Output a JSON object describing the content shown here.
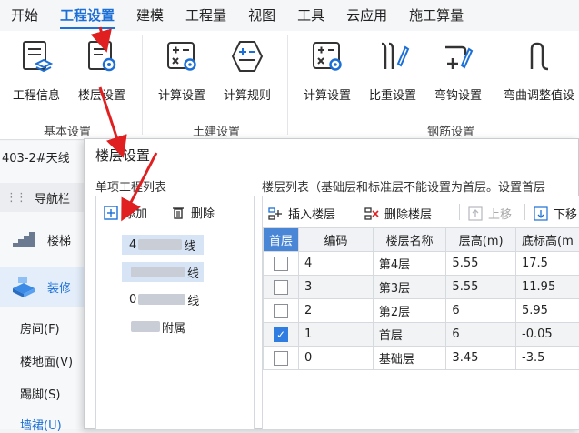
{
  "menu": [
    "开始",
    "工程设置",
    "建模",
    "工程量",
    "视图",
    "工具",
    "云应用",
    "施工算量"
  ],
  "ribbon": {
    "buttons": [
      {
        "label": "工程信息",
        "icon": "project-info-icon"
      },
      {
        "label": "楼层设置",
        "icon": "floor-settings-icon"
      },
      {
        "label": "计算设置",
        "icon": "calc-settings-icon"
      },
      {
        "label": "计算规则",
        "icon": "calc-rules-icon"
      },
      {
        "label": "计算设置",
        "icon": "rebar-calc-settings-icon"
      },
      {
        "label": "比重设置",
        "icon": "density-settings-icon"
      },
      {
        "label": "弯钩设置",
        "icon": "hook-settings-icon"
      },
      {
        "label": "弯曲调整值设",
        "icon": "bend-adjust-icon"
      }
    ],
    "groups": [
      "基本设置",
      "土建设置",
      "钢筋设置"
    ]
  },
  "left": {
    "project_title": "403-2#天线",
    "nav_header": "导航栏",
    "nav_items": [
      "楼梯",
      "装修"
    ],
    "sub_items": [
      "房间(F)",
      "楼地面(V)",
      "踢脚(S)",
      "墙裙(U)"
    ]
  },
  "dialog": {
    "title": "楼层设置",
    "project_list_label": "单项工程列表",
    "add_label": "添加",
    "delete_label": "删除",
    "projects": [
      {
        "prefix": "4",
        "suffix": "线"
      },
      {
        "prefix": "",
        "suffix": "线"
      },
      {
        "prefix": "0",
        "suffix": "线"
      },
      {
        "prefix": "",
        "suffix": "附属"
      }
    ],
    "floor_list_label": "楼层列表（基础层和标准层不能设置为首层。设置首层",
    "insert_floor": "插入楼层",
    "delete_floor": "删除楼层",
    "move_up": "上移",
    "move_down": "下移",
    "columns": [
      "首层",
      "编码",
      "楼层名称",
      "层高(m)",
      "底标高(m"
    ],
    "rows": [
      {
        "first": false,
        "code": "4",
        "name": "第4层",
        "height": "5.55",
        "bottom": "17.5"
      },
      {
        "first": false,
        "code": "3",
        "name": "第3层",
        "height": "5.55",
        "bottom": "11.95"
      },
      {
        "first": false,
        "code": "2",
        "name": "第2层",
        "height": "6",
        "bottom": "5.95"
      },
      {
        "first": true,
        "code": "1",
        "name": "首层",
        "height": "6",
        "bottom": "-0.05"
      },
      {
        "first": false,
        "code": "0",
        "name": "基础层",
        "height": "3.45",
        "bottom": "-3.5"
      }
    ]
  },
  "colors": {
    "accent": "#1b6fd6",
    "header_blue": "#4a86d6",
    "annotation": "#e02020"
  }
}
